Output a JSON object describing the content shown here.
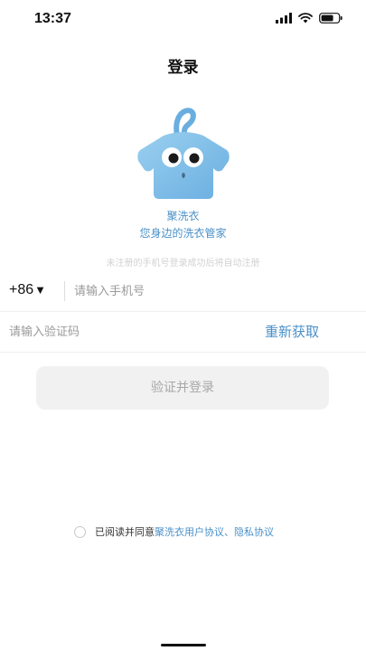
{
  "status_bar": {
    "time": "13:37",
    "icons": [
      "signal-icon",
      "wifi-icon",
      "battery-icon"
    ]
  },
  "header": {
    "title": "登录"
  },
  "brand": {
    "logo_icon": "shirt-hanger-mascot-icon",
    "name": "聚洗衣",
    "slogan": "您身边的洗衣管家",
    "color": "#4a90c8"
  },
  "form": {
    "register_hint": "未注册的手机号登录成功后将自动注册",
    "country_code": "+86",
    "country_arrow": "▼",
    "phone_placeholder": "请输入手机号",
    "code_placeholder": "请输入验证码",
    "resend_label": "重新获取",
    "login_label": "验证并登录"
  },
  "agreement": {
    "prefix": "已阅读并同意",
    "user_agreement": "聚洗衣用户协议",
    "separator": "、",
    "privacy_policy": "隐私协议",
    "checked": false
  }
}
